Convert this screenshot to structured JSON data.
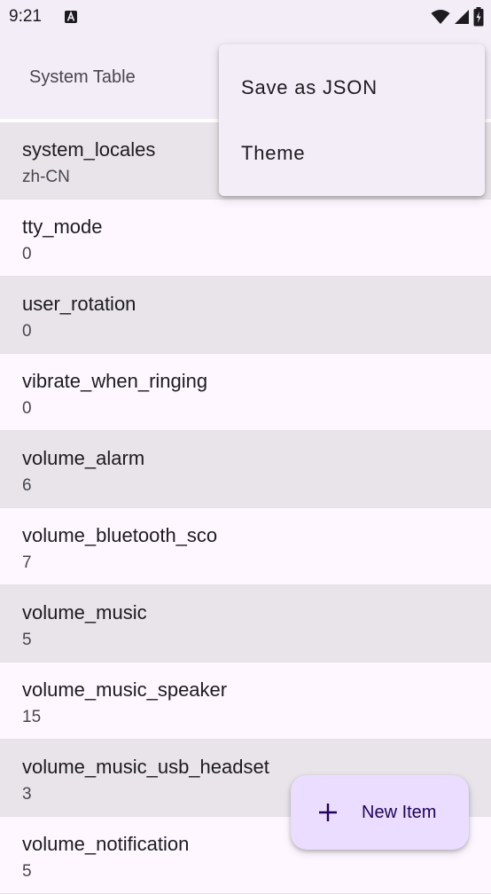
{
  "status_bar": {
    "time": "9:21",
    "notification_icon": "a-letter-icon",
    "right_icons": [
      "wifi-icon",
      "cell-signal-icon",
      "battery-icon"
    ]
  },
  "app_bar": {
    "title": "System Table"
  },
  "menu": {
    "items": [
      {
        "label": "Save as JSON"
      },
      {
        "label": "Theme"
      }
    ]
  },
  "rows": [
    {
      "key": "system_locales",
      "value": "zh-CN"
    },
    {
      "key": "tty_mode",
      "value": "0"
    },
    {
      "key": "user_rotation",
      "value": "0"
    },
    {
      "key": "vibrate_when_ringing",
      "value": "0"
    },
    {
      "key": "volume_alarm",
      "value": "6"
    },
    {
      "key": "volume_bluetooth_sco",
      "value": "7"
    },
    {
      "key": "volume_music",
      "value": "5"
    },
    {
      "key": "volume_music_speaker",
      "value": "15"
    },
    {
      "key": "volume_music_usb_headset",
      "value": "3"
    },
    {
      "key": "volume_notification",
      "value": "5"
    }
  ],
  "fab": {
    "label": "New Item",
    "icon": "plus-icon"
  },
  "colors": {
    "background": "#fef7ff",
    "surface": "#f3edf7",
    "shaded_row": "#e8e4ea",
    "fab": "#eaddff",
    "fab_text": "#21005d"
  }
}
